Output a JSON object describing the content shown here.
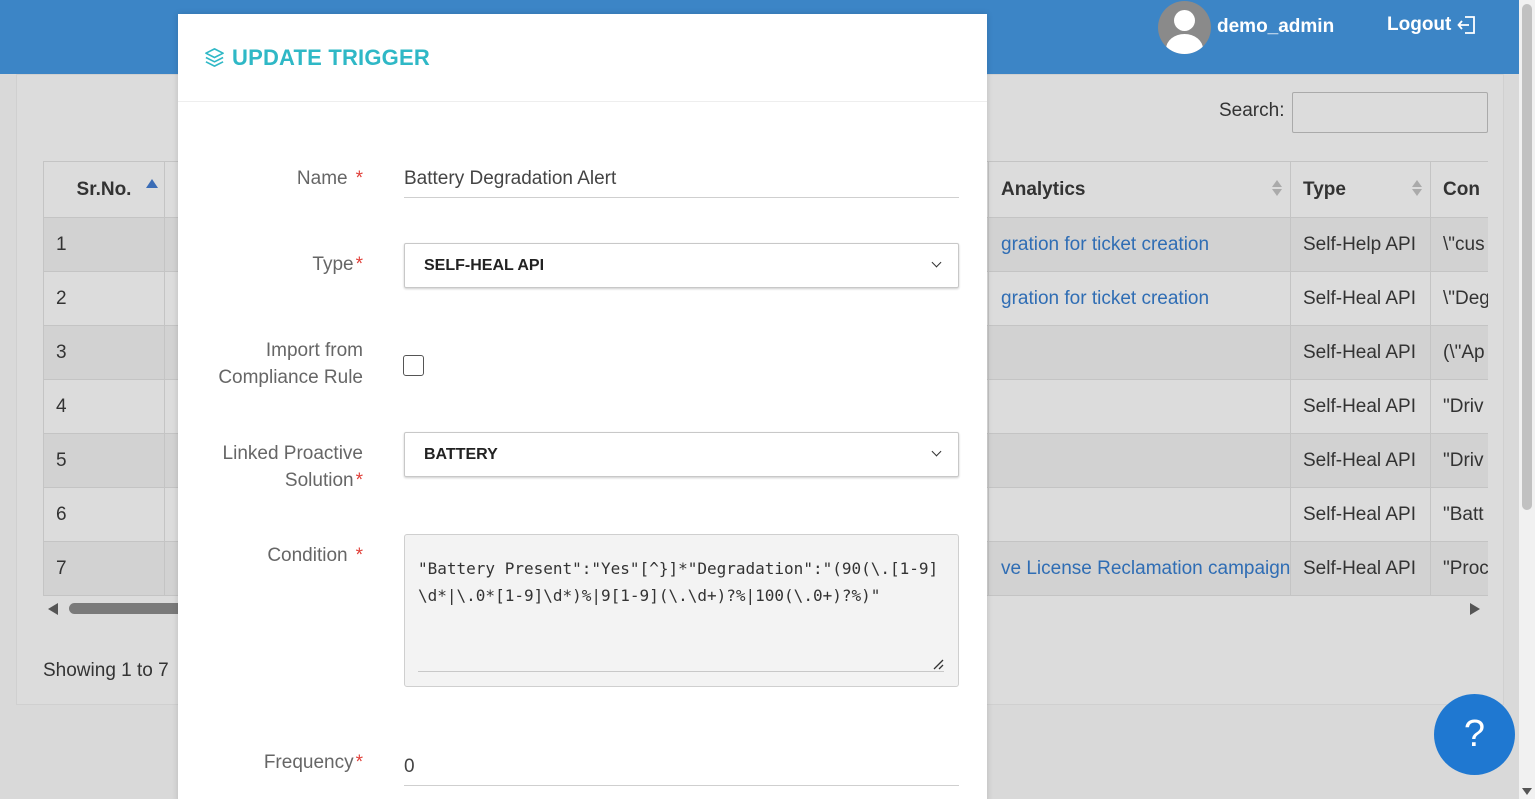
{
  "header": {
    "username": "demo_admin",
    "logout_label": "Logout",
    "color": "#3c85c6"
  },
  "list": {
    "search_label": "Search:",
    "search_value": "",
    "columns": {
      "sr": "Sr.No.",
      "analytics": "Analytics",
      "type": "Type",
      "condition": "Con"
    },
    "rows": [
      {
        "sr": "1",
        "analytics": "gration for ticket creation",
        "type": "Self-Help API",
        "condition": "\\\"cus"
      },
      {
        "sr": "2",
        "analytics": "gration for ticket creation",
        "type": "Self-Heal API",
        "condition": "\\\"Deg"
      },
      {
        "sr": "3",
        "analytics": "",
        "type": "Self-Heal API",
        "condition": "(\\\"Ap"
      },
      {
        "sr": "4",
        "analytics": "",
        "type": "Self-Heal API",
        "condition": "\"Driv"
      },
      {
        "sr": "5",
        "analytics": "",
        "type": "Self-Heal API",
        "condition": "\"Driv"
      },
      {
        "sr": "6",
        "analytics": "",
        "type": "Self-Heal API",
        "condition": "\"Batt"
      },
      {
        "sr": "7",
        "analytics": "ve License Reclamation campaign",
        "type": "Self-Heal API",
        "condition": "\"Proc"
      }
    ],
    "showing_text": "Showing 1 to 7"
  },
  "modal": {
    "title": "UPDATE TRIGGER",
    "title_color": "#2fb8c6",
    "name_label": "Name",
    "name_value": "Battery Degradation Alert",
    "type_label": "Type",
    "type_value": "SELF-HEAL API",
    "import_label_line1": "Import from",
    "import_label_line2": "Compliance Rule",
    "import_checked": false,
    "linked_label_line1": "Linked Proactive",
    "linked_label_line2": "Solution",
    "linked_value": "BATTERY",
    "condition_label": "Condition",
    "condition_value": "\"Battery Present\":\"Yes\"[^}]*\"Degradation\":\"(90(\\.[1-9]\\d*|\\.0*[1-9]\\d*)%|9[1-9](\\.\\d+)?%|100(\\.0+)?%)\"",
    "frequency_label": "Frequency",
    "frequency_value": "0",
    "required_mark": "*"
  },
  "help": {
    "label": "?",
    "color": "#1f78d1"
  }
}
